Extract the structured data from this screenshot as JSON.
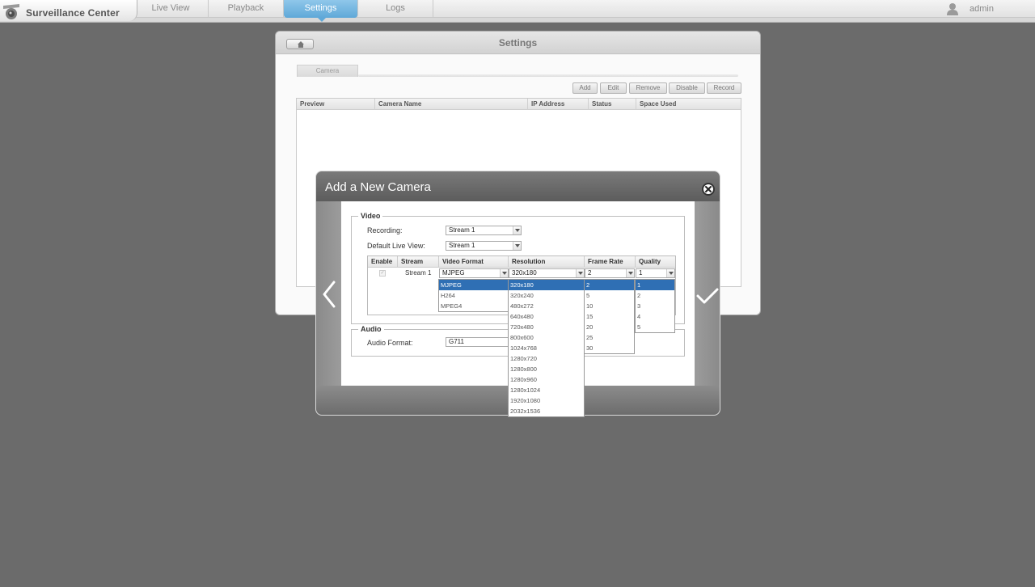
{
  "app": {
    "title": "Surveillance Center",
    "user": "admin"
  },
  "nav": {
    "tabs": [
      "Live View",
      "Playback",
      "Settings",
      "Logs"
    ],
    "active": "Settings"
  },
  "settings": {
    "title": "Settings",
    "tab": "Camera",
    "toolbar": [
      "Add",
      "Edit",
      "Remove",
      "Disable",
      "Record"
    ],
    "columns": [
      "Preview",
      "Camera Name",
      "IP Address",
      "Status",
      "Space Used"
    ]
  },
  "modal": {
    "title": "Add a New Camera",
    "video": {
      "legend": "Video",
      "recording_label": "Recording:",
      "recording_value": "Stream 1",
      "live_view_label": "Default Live View:",
      "live_view_value": "Stream 1"
    },
    "stream_table": {
      "columns": [
        "Enable",
        "Stream",
        "Video Format",
        "Resolution",
        "Frame Rate",
        "Quality"
      ],
      "row": {
        "stream": "Stream 1",
        "video_format": "MJPEG",
        "resolution": "320x180",
        "frame_rate": "2",
        "quality": "1"
      }
    },
    "audio": {
      "legend": "Audio",
      "format_label": "Audio Format:",
      "format_value": "G711"
    },
    "dropdowns": {
      "video_format": [
        "MJPEG",
        "H264",
        "MPEG4"
      ],
      "resolution": [
        "320x180",
        "320x240",
        "480x272",
        "640x480",
        "720x480",
        "800x600",
        "1024x768",
        "1280x720",
        "1280x800",
        "1280x960",
        "1280x1024",
        "1920x1080",
        "2032x1536"
      ],
      "frame_rate": [
        "2",
        "5",
        "10",
        "15",
        "20",
        "25",
        "30"
      ],
      "quality": [
        "1",
        "2",
        "3",
        "4",
        "5"
      ]
    }
  }
}
